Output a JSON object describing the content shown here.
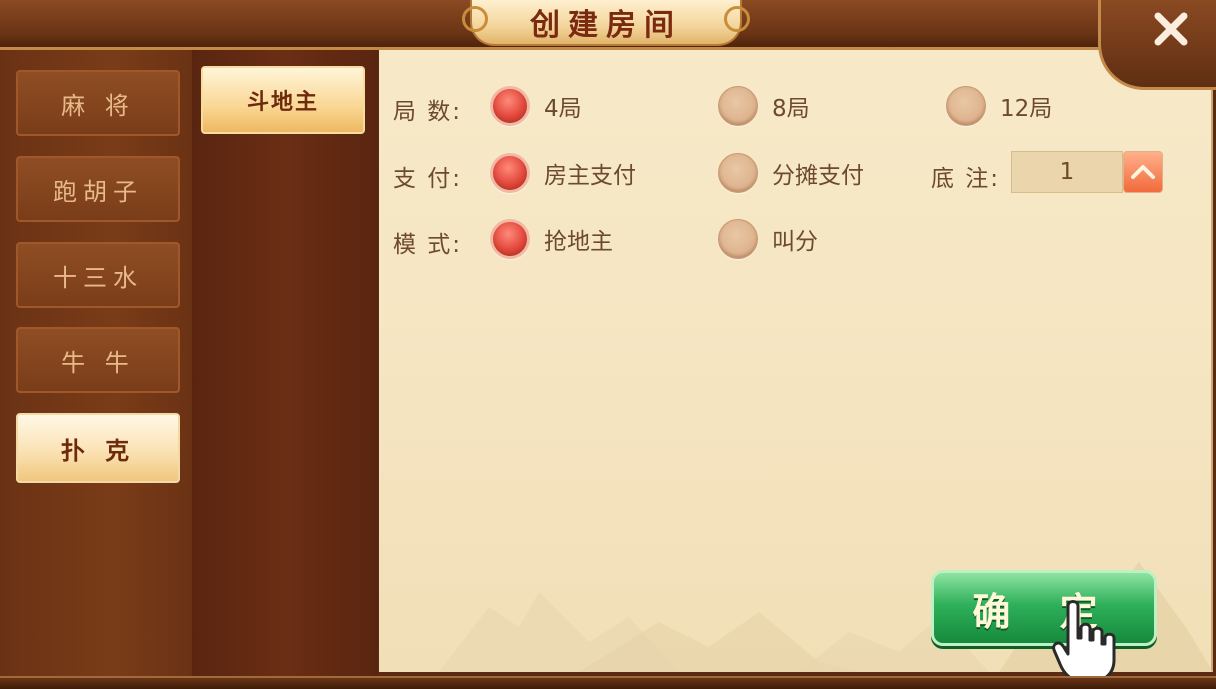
{
  "window": {
    "title": "创建房间",
    "close_icon": "close-icon"
  },
  "categories": [
    {
      "label": "麻 将",
      "active": false
    },
    {
      "label": "跑胡子",
      "active": false
    },
    {
      "label": "十三水",
      "active": false
    },
    {
      "label": "牛 牛",
      "active": false
    },
    {
      "label": "扑 克",
      "active": true
    }
  ],
  "subcategories": [
    {
      "label": "斗地主",
      "active": true
    }
  ],
  "settings": {
    "rounds": {
      "label": "局 数:",
      "options": [
        {
          "label": "4局",
          "selected": true
        },
        {
          "label": "8局",
          "selected": false
        },
        {
          "label": "12局",
          "selected": false
        }
      ]
    },
    "payment": {
      "label": "支 付:",
      "options": [
        {
          "label": "房主支付",
          "selected": true
        },
        {
          "label": "分摊支付",
          "selected": false
        }
      ]
    },
    "base_bet": {
      "label": "底 注:",
      "value": "1",
      "increment_icon": "chevron-up-icon"
    },
    "mode": {
      "label": "模 式:",
      "options": [
        {
          "label": "抢地主",
          "selected": true
        },
        {
          "label": "叫分",
          "selected": false
        }
      ]
    }
  },
  "actions": {
    "confirm_label": "确 定"
  },
  "colors": {
    "selected_radio": "#e2483c",
    "confirm_button": "#2fb05a",
    "parchment": "#f6e6c3",
    "frame_brown": "#6b3516"
  }
}
